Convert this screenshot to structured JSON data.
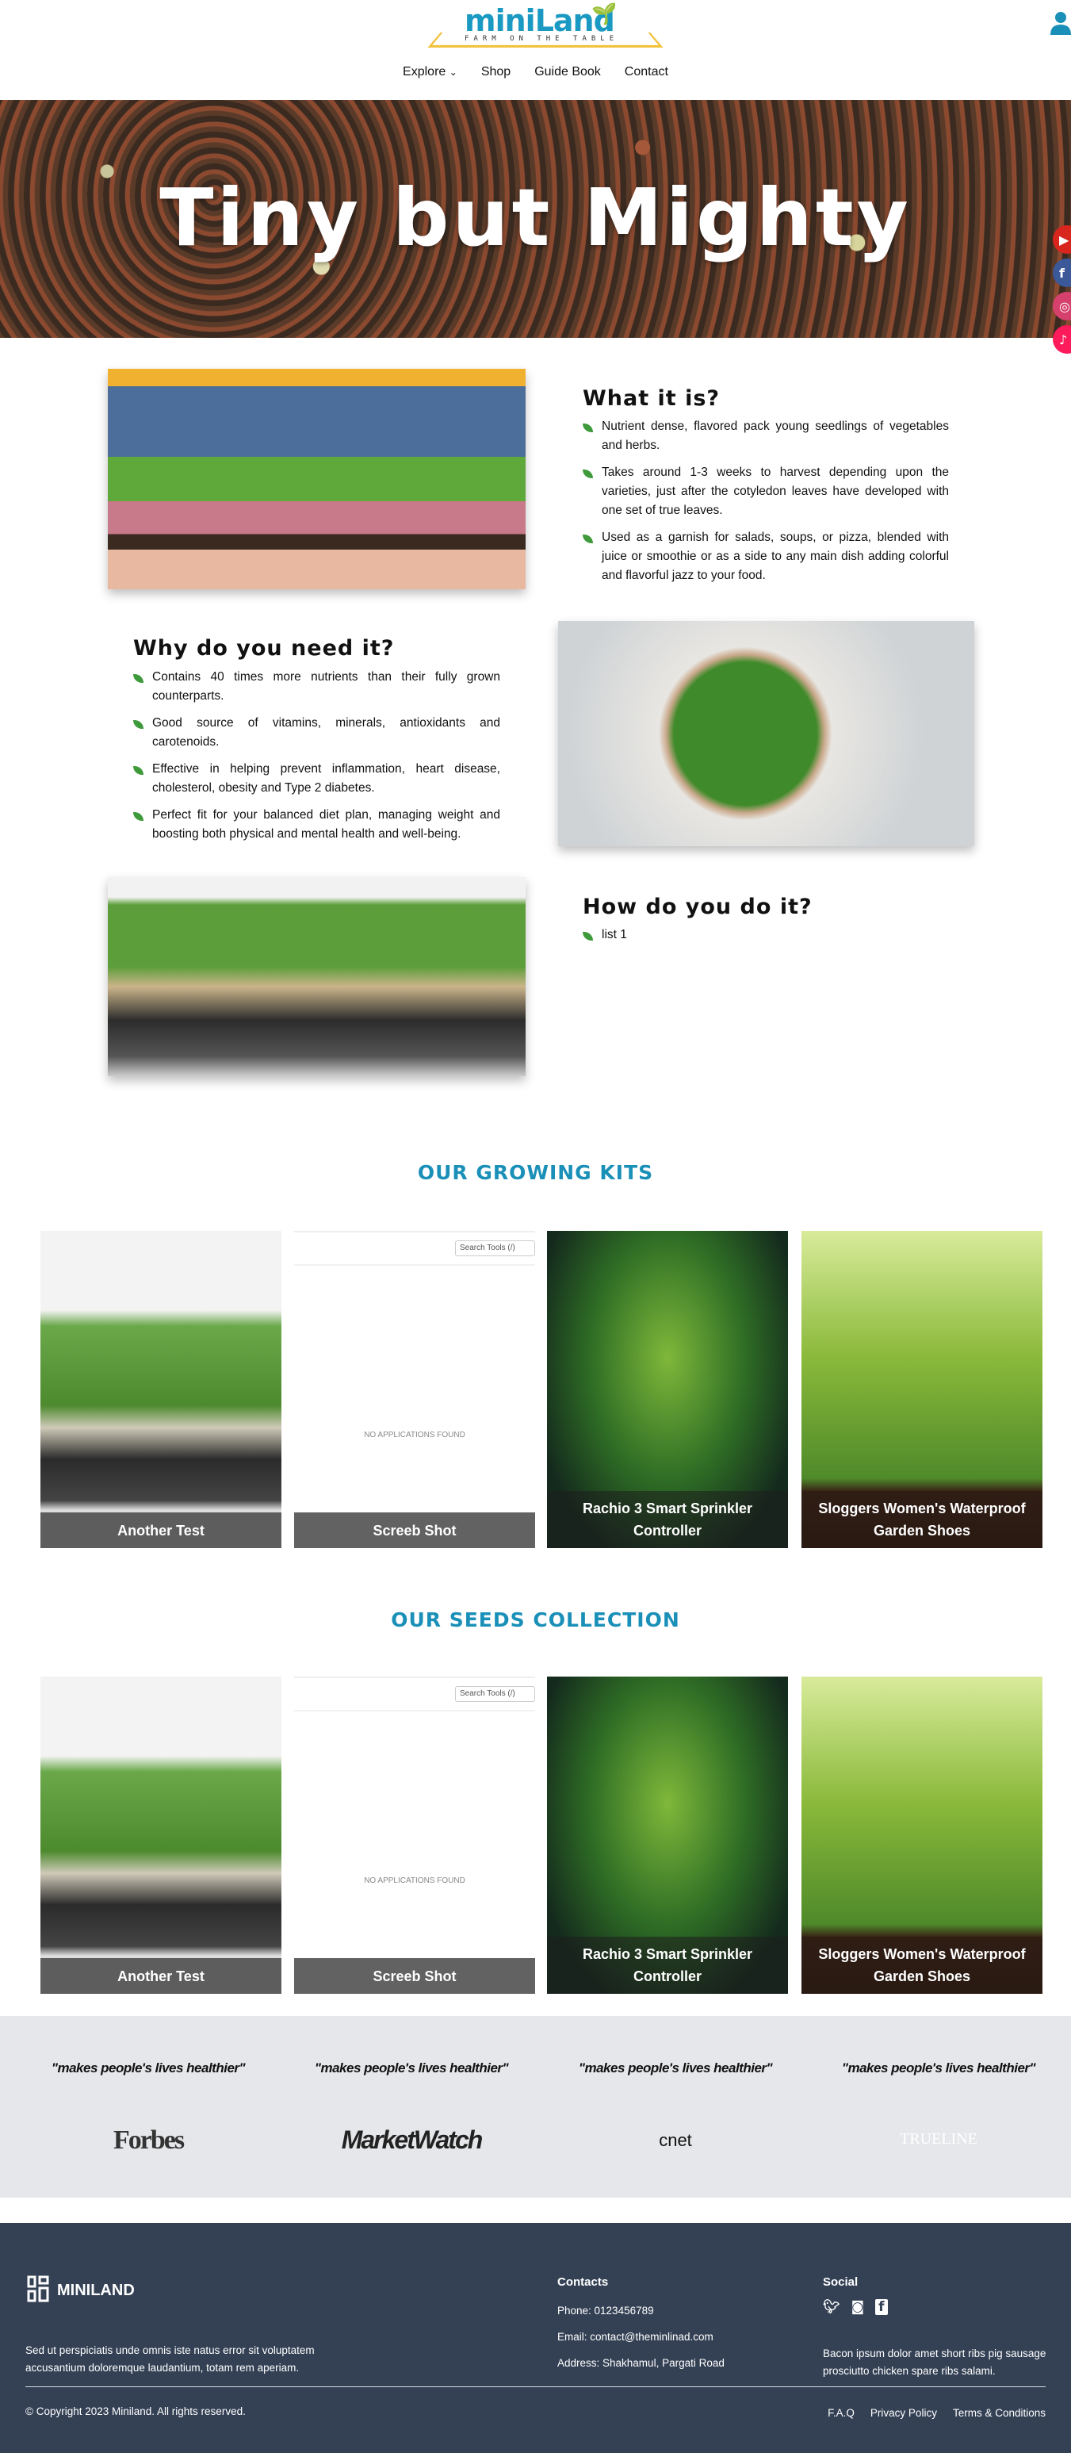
{
  "header": {
    "logo_text": "miniLand",
    "logo_tagline": "FARM ON THE TABLE",
    "nav": [
      {
        "label": "Explore",
        "has_dropdown": true
      },
      {
        "label": "Shop"
      },
      {
        "label": "Guide Book"
      },
      {
        "label": "Contact"
      }
    ],
    "user_icon": "user-icon"
  },
  "hero": {
    "title": "Tiny but Mighty",
    "social": [
      {
        "icon": "youtube-icon",
        "color": "#d8261e"
      },
      {
        "icon": "facebook-icon",
        "color": "#3b5998"
      },
      {
        "icon": "instagram-icon",
        "color": "#d6406c"
      },
      {
        "icon": "tiktok-icon",
        "color": "#fe1b5b"
      }
    ]
  },
  "sections": [
    {
      "title": "What it is?",
      "items": [
        "Nutrient dense, flavored pack young seedlings of vegetables and herbs.",
        "Takes around 1-3 weeks to harvest depending upon the varieties, just after the cotyledon leaves have developed with one set of true leaves.",
        "Used as a garnish for salads, soups, or pizza, blended with juice or smoothie or as a side to any main dish adding colorful and flavorful jazz to your food."
      ]
    },
    {
      "title": "Why do you need it?",
      "items": [
        "Contains 40 times more nutrients than their fully grown counterparts.",
        "Good source of vitamins, minerals, antioxidants and carotenoids.",
        "Effective in helping prevent inflammation, heart disease, cholesterol, obesity and Type 2 diabetes.",
        "Perfect fit for your balanced diet plan, managing weight and boosting both physical and mental health and well-being."
      ]
    },
    {
      "title": "How do you do it?",
      "items": [
        "list 1"
      ]
    }
  ],
  "kits": {
    "title": "OUR GROWING KITS",
    "cards": [
      {
        "label": "Another Test"
      },
      {
        "label": "Screeb Shot",
        "search_placeholder": "Search Tools (/)",
        "empty_text": "NO APPLICATIONS FOUND"
      },
      {
        "label": "Rachio 3 Smart Sprinkler Controller"
      },
      {
        "label": "Sloggers Women's Waterproof Garden Shoes"
      }
    ]
  },
  "seeds": {
    "title": "OUR SEEDS COLLECTION",
    "cards": [
      {
        "label": "Another Test"
      },
      {
        "label": "Screeb Shot",
        "search_placeholder": "Search Tools (/)",
        "empty_text": "NO APPLICATIONS FOUND"
      },
      {
        "label": "Rachio 3 Smart Sprinkler Controller"
      },
      {
        "label": "Sloggers Women's Waterproof Garden Shoes"
      }
    ]
  },
  "testimonials": {
    "quotes": [
      "\"makes people's lives healthier\"",
      "\"makes people's lives healthier\"",
      "\"makes people's lives healthier\"",
      "\"makes people's lives healthier\""
    ],
    "brands": [
      "Forbes",
      "MarketWatch",
      "cnet",
      "TRUELINE"
    ]
  },
  "footer": {
    "brand": "MINILAND",
    "about": "Sed ut perspiciatis unde omnis iste natus error sit voluptatem accusantium doloremque laudantium, totam rem aperiam.",
    "contacts_title": "Contacts",
    "phone": "Phone: 0123456789",
    "email": "Email: contact@theminlinad.com",
    "address": "Address: Shakhamul, Pargati Road",
    "social_title": "Social",
    "social_icons": [
      "twitter-icon",
      "instagram-icon",
      "facebook-icon"
    ],
    "social_text": "Bacon ipsum dolor amet short ribs pig sausage prosciutto chicken spare ribs salami.",
    "copyright": "© Copyright 2023 Miniland. All rights reserved.",
    "links": [
      "F.A.Q",
      "Privacy Policy",
      "Terms & Conditions"
    ]
  },
  "colors": {
    "accent": "#1a90b8",
    "footer_bg": "#344155",
    "band_bg": "#e6e7ea",
    "leaf": "#3e9a3a"
  }
}
